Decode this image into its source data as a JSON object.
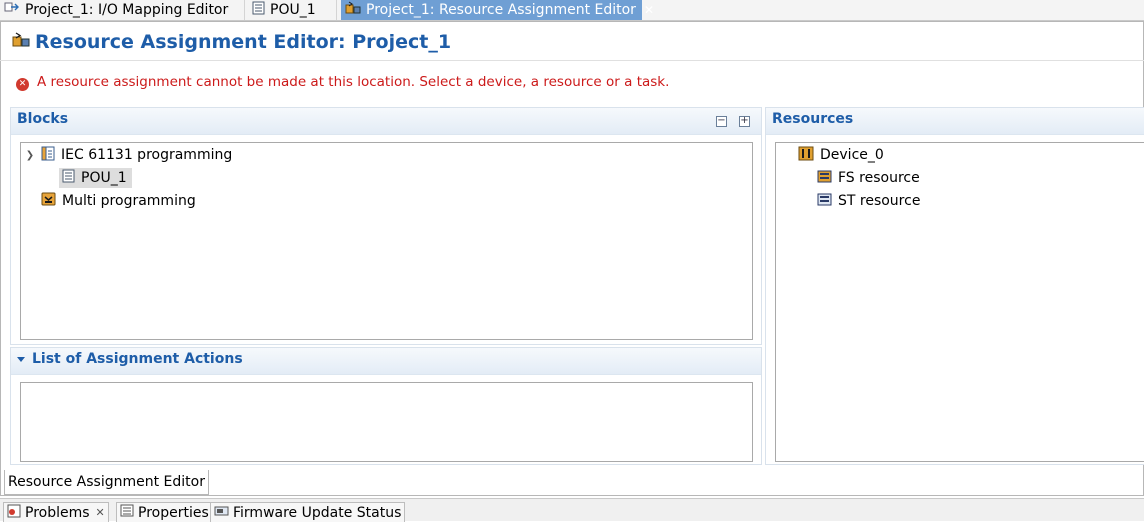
{
  "editor_tabs": [
    {
      "label": "Project_1: I/O Mapping Editor",
      "icon": "io-mapping-icon",
      "active": false
    },
    {
      "label": "POU_1",
      "icon": "pou-icon",
      "active": false
    },
    {
      "label": "Project_1: Resource Assignment Editor",
      "icon": "resource-assignment-icon",
      "active": true
    }
  ],
  "editor": {
    "title": "Resource Assignment Editor: Project_1",
    "error_message": "A resource assignment cannot be made at this location. Select a device, a resource or a task."
  },
  "blocks": {
    "title": "Blocks",
    "tree": [
      {
        "label": "IEC 61131 programming",
        "expanded": true,
        "icon": "iec-programming-icon"
      },
      {
        "label": "POU_1",
        "selected": true,
        "icon": "pou-icon"
      },
      {
        "label": "Multi programming",
        "icon": "multi-programming-icon"
      }
    ]
  },
  "resources": {
    "title": "Resources",
    "tree": [
      {
        "label": "Device_0",
        "icon": "device-icon"
      },
      {
        "label": "FS resource",
        "icon": "fs-resource-icon"
      },
      {
        "label": "ST resource",
        "icon": "st-resource-icon"
      }
    ]
  },
  "assignment_actions": {
    "title": "List of Assignment Actions"
  },
  "bottom_tab": {
    "label": "Resource Assignment Editor"
  },
  "view_tabs": [
    {
      "label": "Problems",
      "icon": "problems-icon"
    },
    {
      "label": "Properties",
      "icon": "properties-icon"
    },
    {
      "label": "Firmware Update Status",
      "icon": "firmware-update-icon"
    }
  ],
  "colors": {
    "accent": "#1e5da8",
    "error": "#cc1a1a",
    "active_tab": "#6f9fd4"
  }
}
